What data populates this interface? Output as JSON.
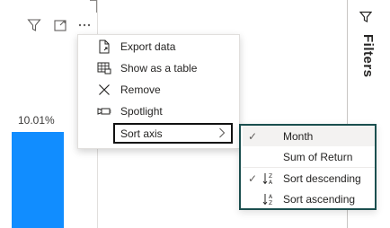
{
  "visual": {
    "data_label": "10.01%",
    "bar_color": "#118dff"
  },
  "header_icons": [
    "filter-icon",
    "focus-mode-icon",
    "more-options-icon"
  ],
  "context_menu": {
    "items": [
      {
        "label": "Export data",
        "icon": "export-data-icon"
      },
      {
        "label": "Show as a table",
        "icon": "table-icon"
      },
      {
        "label": "Remove",
        "icon": "close-icon"
      },
      {
        "label": "Spotlight",
        "icon": "spotlight-icon"
      }
    ],
    "sort_axis": {
      "label": "Sort axis"
    }
  },
  "submenu": {
    "items": [
      {
        "label": "Month",
        "checked": true
      },
      {
        "label": "Sum of Return",
        "checked": false
      },
      {
        "label": "Sort descending",
        "checked": true,
        "icon": "sort-descending-icon"
      },
      {
        "label": "Sort ascending",
        "checked": false,
        "icon": "sort-ascending-icon"
      }
    ]
  },
  "filters_pane": {
    "label": "Filters"
  }
}
